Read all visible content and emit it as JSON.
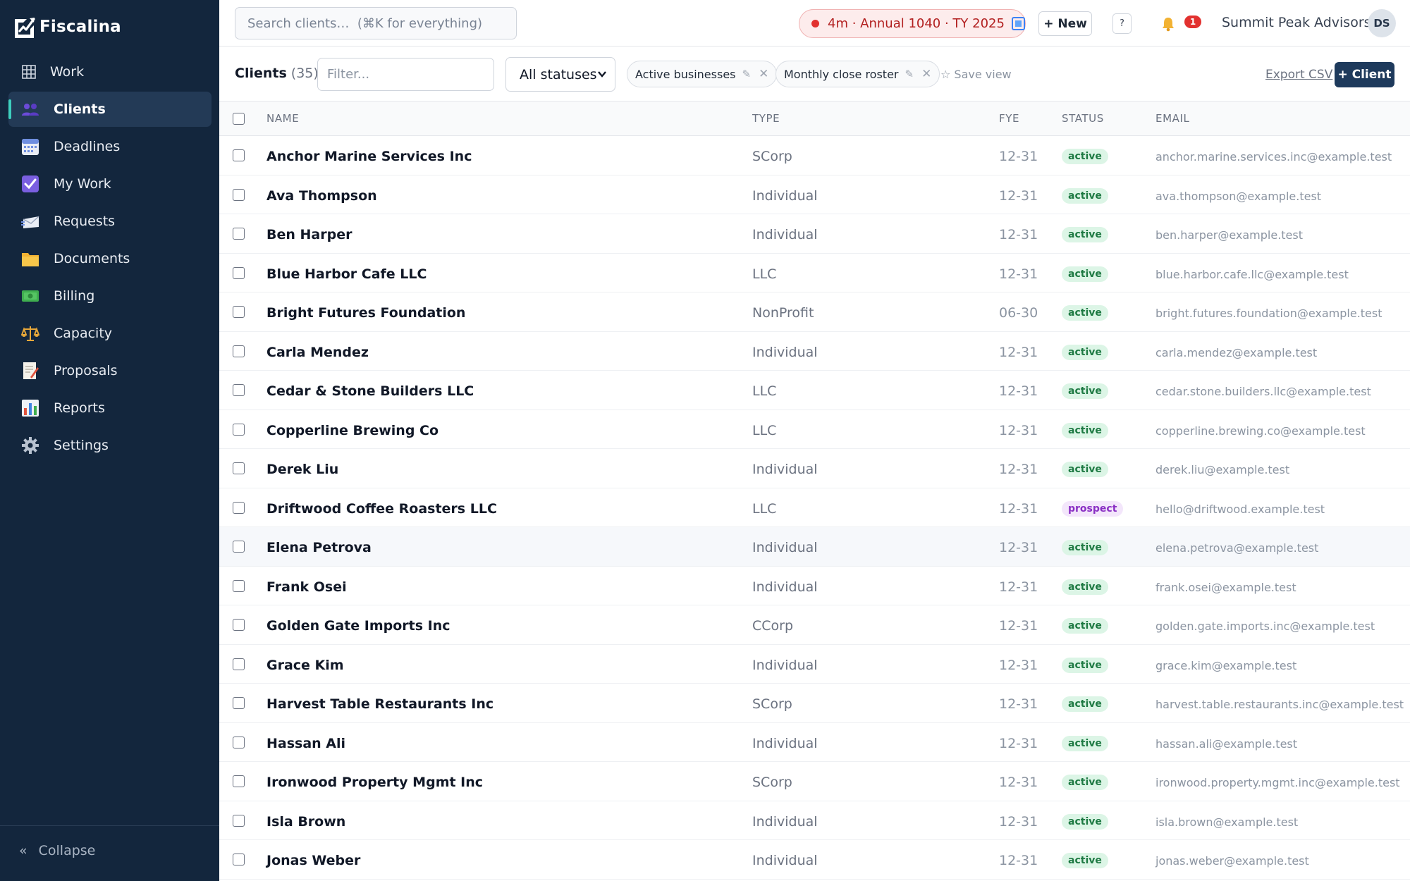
{
  "brand": {
    "name": "Fiscalina"
  },
  "sidebar": {
    "items": [
      {
        "label": "Work",
        "icon": "grid-icon"
      },
      {
        "label": "Clients",
        "icon": "users-icon",
        "active": true
      },
      {
        "label": "Deadlines",
        "icon": "calendar-icon"
      },
      {
        "label": "My Work",
        "icon": "checkbox-icon"
      },
      {
        "label": "Requests",
        "icon": "incoming-envelope-icon"
      },
      {
        "label": "Documents",
        "icon": "folder-icon"
      },
      {
        "label": "Billing",
        "icon": "money-icon"
      },
      {
        "label": "Capacity",
        "icon": "scales-icon"
      },
      {
        "label": "Proposals",
        "icon": "memo-icon"
      },
      {
        "label": "Reports",
        "icon": "bar-chart-icon"
      },
      {
        "label": "Settings",
        "icon": "gear-icon"
      }
    ],
    "collapse_icon": "«",
    "collapse_label": "Collapse"
  },
  "topbar": {
    "search_placeholder": "Search clients…  (⌘K for everything)",
    "timer_text": "4m · Annual 1040 · TY 2025",
    "new_label": "+ New",
    "help_label": "?",
    "notification_count": "1",
    "org_name": "Summit Peak Advisors",
    "avatar_initials": "DS"
  },
  "toolbar": {
    "title": "Clients",
    "count": "(35)",
    "filter_placeholder": "Filter...",
    "status_select": "All statuses",
    "chips": [
      {
        "label": "Active businesses"
      },
      {
        "label": "Monthly close roster"
      }
    ],
    "chip_edit_icon": "✎",
    "chip_remove_icon": "✕",
    "save_view": "☆ Save view",
    "export": "Export CSV",
    "add_client": "+ Client"
  },
  "table": {
    "headers": {
      "name": "NAME",
      "type": "TYPE",
      "fye": "FYE",
      "status": "STATUS",
      "email": "EMAIL"
    },
    "rows": [
      {
        "name": "Anchor Marine Services Inc",
        "type": "SCorp",
        "fye": "12-31",
        "status": "active",
        "email": "anchor.marine.services.inc@example.test"
      },
      {
        "name": "Ava Thompson",
        "type": "Individual",
        "fye": "12-31",
        "status": "active",
        "email": "ava.thompson@example.test"
      },
      {
        "name": "Ben Harper",
        "type": "Individual",
        "fye": "12-31",
        "status": "active",
        "email": "ben.harper@example.test"
      },
      {
        "name": "Blue Harbor Cafe LLC",
        "type": "LLC",
        "fye": "12-31",
        "status": "active",
        "email": "blue.harbor.cafe.llc@example.test"
      },
      {
        "name": "Bright Futures Foundation",
        "type": "NonProfit",
        "fye": "06-30",
        "status": "active",
        "email": "bright.futures.foundation@example.test"
      },
      {
        "name": "Carla Mendez",
        "type": "Individual",
        "fye": "12-31",
        "status": "active",
        "email": "carla.mendez@example.test"
      },
      {
        "name": "Cedar & Stone Builders LLC",
        "type": "LLC",
        "fye": "12-31",
        "status": "active",
        "email": "cedar.stone.builders.llc@example.test"
      },
      {
        "name": "Copperline Brewing Co",
        "type": "LLC",
        "fye": "12-31",
        "status": "active",
        "email": "copperline.brewing.co@example.test"
      },
      {
        "name": "Derek Liu",
        "type": "Individual",
        "fye": "12-31",
        "status": "active",
        "email": "derek.liu@example.test"
      },
      {
        "name": "Driftwood Coffee Roasters LLC",
        "type": "LLC",
        "fye": "12-31",
        "status": "prospect",
        "email": "hello@driftwood.example.test"
      },
      {
        "name": "Elena Petrova",
        "type": "Individual",
        "fye": "12-31",
        "status": "active",
        "email": "elena.petrova@example.test"
      },
      {
        "name": "Frank Osei",
        "type": "Individual",
        "fye": "12-31",
        "status": "active",
        "email": "frank.osei@example.test"
      },
      {
        "name": "Golden Gate Imports Inc",
        "type": "CCorp",
        "fye": "12-31",
        "status": "active",
        "email": "golden.gate.imports.inc@example.test"
      },
      {
        "name": "Grace Kim",
        "type": "Individual",
        "fye": "12-31",
        "status": "active",
        "email": "grace.kim@example.test"
      },
      {
        "name": "Harvest Table Restaurants Inc",
        "type": "SCorp",
        "fye": "12-31",
        "status": "active",
        "email": "harvest.table.restaurants.inc@example.test"
      },
      {
        "name": "Hassan Ali",
        "type": "Individual",
        "fye": "12-31",
        "status": "active",
        "email": "hassan.ali@example.test"
      },
      {
        "name": "Ironwood Property Mgmt Inc",
        "type": "SCorp",
        "fye": "12-31",
        "status": "active",
        "email": "ironwood.property.mgmt.inc@example.test"
      },
      {
        "name": "Isla Brown",
        "type": "Individual",
        "fye": "12-31",
        "status": "active",
        "email": "isla.brown@example.test"
      },
      {
        "name": "Jonas Weber",
        "type": "Individual",
        "fye": "12-31",
        "status": "active",
        "email": "jonas.weber@example.test"
      }
    ]
  },
  "colors": {
    "sidebar_bg": "#13263d",
    "active_accent": "#3ecfbe",
    "primary_button": "#1e3a5c",
    "timer_red": "#e2312f",
    "active_badge_bg": "#dcf5e6",
    "prospect_badge_bg": "#f3e6fb"
  }
}
